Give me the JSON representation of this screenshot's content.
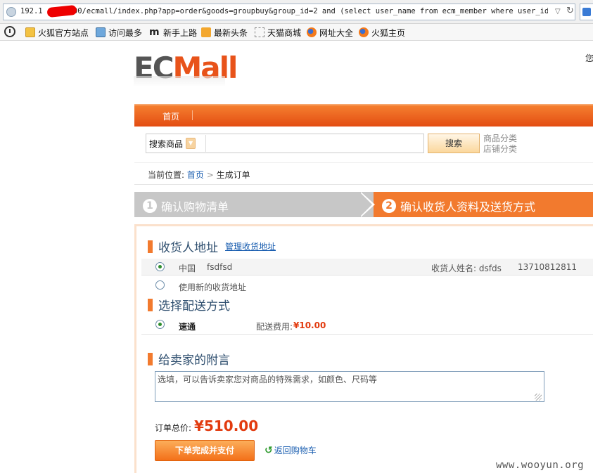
{
  "browser": {
    "url_prefix": "192.1",
    "url_rest": "4:8000/ecmall/index.php?app=order&goods=groupbuy&group_id=2 and (select user_name from ecm_member where user_id=",
    "bookmarks": [
      {
        "label": "火狐官方站点",
        "icon": "folder-icon"
      },
      {
        "label": "访问最多",
        "icon": "folder-icon"
      },
      {
        "label": "新手上路",
        "icon": "m-icon"
      },
      {
        "label": "最新头条",
        "icon": "rss-icon"
      },
      {
        "label": "天猫商城",
        "icon": "dashed-box-icon"
      },
      {
        "label": "网址大全",
        "icon": "firefox-icon"
      },
      {
        "label": "火狐主页",
        "icon": "firefox-icon"
      }
    ]
  },
  "header": {
    "logo_ec": "EC",
    "logo_mall": "Mall",
    "top_right_text": "您"
  },
  "nav": {
    "home": "首页"
  },
  "search": {
    "scope": "搜索商品",
    "button": "搜索",
    "link_goods_category": "商品分类",
    "link_store_category": "店铺分类"
  },
  "breadcrumb": {
    "label": "当前位置:",
    "home": "首页",
    "separator": ">",
    "current": "生成订单"
  },
  "steps": [
    {
      "num": "1",
      "label": "确认购物清单"
    },
    {
      "num": "2",
      "label": "确认收货人资料及送货方式"
    }
  ],
  "address_section": {
    "title": "收货人地址",
    "manage_link": "管理收货地址",
    "saved": {
      "region": "中国",
      "address": "fsdfsd",
      "consignee": "收货人姓名: dsfds",
      "phone": "13710812811"
    },
    "new_address": "使用新的收货地址"
  },
  "shipping_section": {
    "title": "选择配送方式",
    "method": "速通",
    "fee_label": "配送费用:",
    "fee": "¥10.00"
  },
  "message_section": {
    "title": "给卖家的附言",
    "placeholder": "选填，可以告诉卖家您对商品的特殊需求，如颜色、尺码等"
  },
  "order": {
    "total_label": "订单总价:",
    "total_value": "¥510.00",
    "submit": "下单完成并支付",
    "back": "返回购物车"
  },
  "watermark": "www.wooyun.org",
  "colors": {
    "accent": "#f27a2e",
    "price": "#e23a0e",
    "link": "#1a5eb0"
  }
}
